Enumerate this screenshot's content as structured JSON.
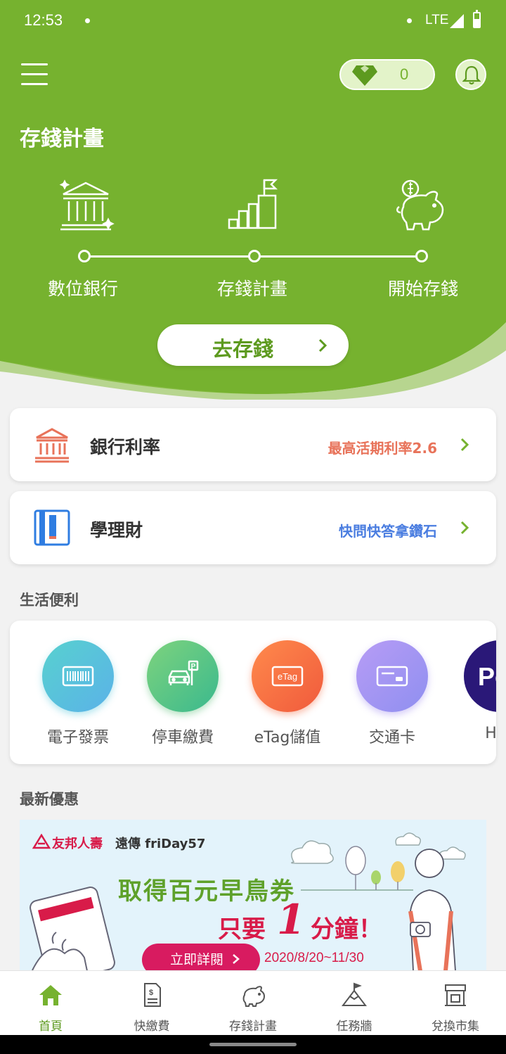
{
  "status_bar": {
    "time": "12:53",
    "network": "LTE"
  },
  "header": {
    "diamond_count": "0",
    "menu_icon": "menu-icon",
    "bell_icon": "bell-icon"
  },
  "hero": {
    "title": "存錢計畫",
    "steps": [
      {
        "label": "數位銀行",
        "icon": "bank-icon"
      },
      {
        "label": "存錢計畫",
        "icon": "growth-chart-icon"
      },
      {
        "label": "開始存錢",
        "icon": "piggy-bank-icon"
      }
    ],
    "cta": "去存錢"
  },
  "cards": {
    "bank_rate": {
      "label": "銀行利率",
      "note": "最高活期利率2.6"
    },
    "finance": {
      "label": "學理財",
      "note": "快問快答拿鑽石"
    }
  },
  "life": {
    "title": "生活便利",
    "items": [
      {
        "label": "電子發票",
        "icon": "barcode-icon"
      },
      {
        "label": "停車繳費",
        "icon": "car-parking-icon"
      },
      {
        "label": "eTag儲值",
        "icon": "etag-icon"
      },
      {
        "label": "交通卡",
        "icon": "card-icon"
      },
      {
        "label": "HG",
        "icon": "happygo-icon"
      }
    ],
    "etag_text": "eTag",
    "hg_logo": "Po"
  },
  "promo": {
    "title": "最新優惠",
    "brand1": "友邦人壽",
    "brand2": "遠傳 friDay57",
    "headline": "取得百元早鳥券",
    "sub_a": "只要",
    "sub_num": "1",
    "sub_b": "分鐘！",
    "button": "立即詳閱",
    "date": "2020/8/20~11/30"
  },
  "nav": {
    "items": [
      {
        "label": "首頁",
        "icon": "home-icon",
        "active": true
      },
      {
        "label": "快繳費",
        "icon": "bill-icon"
      },
      {
        "label": "存錢計畫",
        "icon": "piggy-icon"
      },
      {
        "label": "任務牆",
        "icon": "mountain-flag-icon"
      },
      {
        "label": "兌換市集",
        "icon": "store-icon"
      }
    ]
  },
  "colors": {
    "primary_green": "#76b22f",
    "accent_red": "#e8735a",
    "accent_blue": "#4a7de0",
    "promo_red": "#d81b49"
  }
}
